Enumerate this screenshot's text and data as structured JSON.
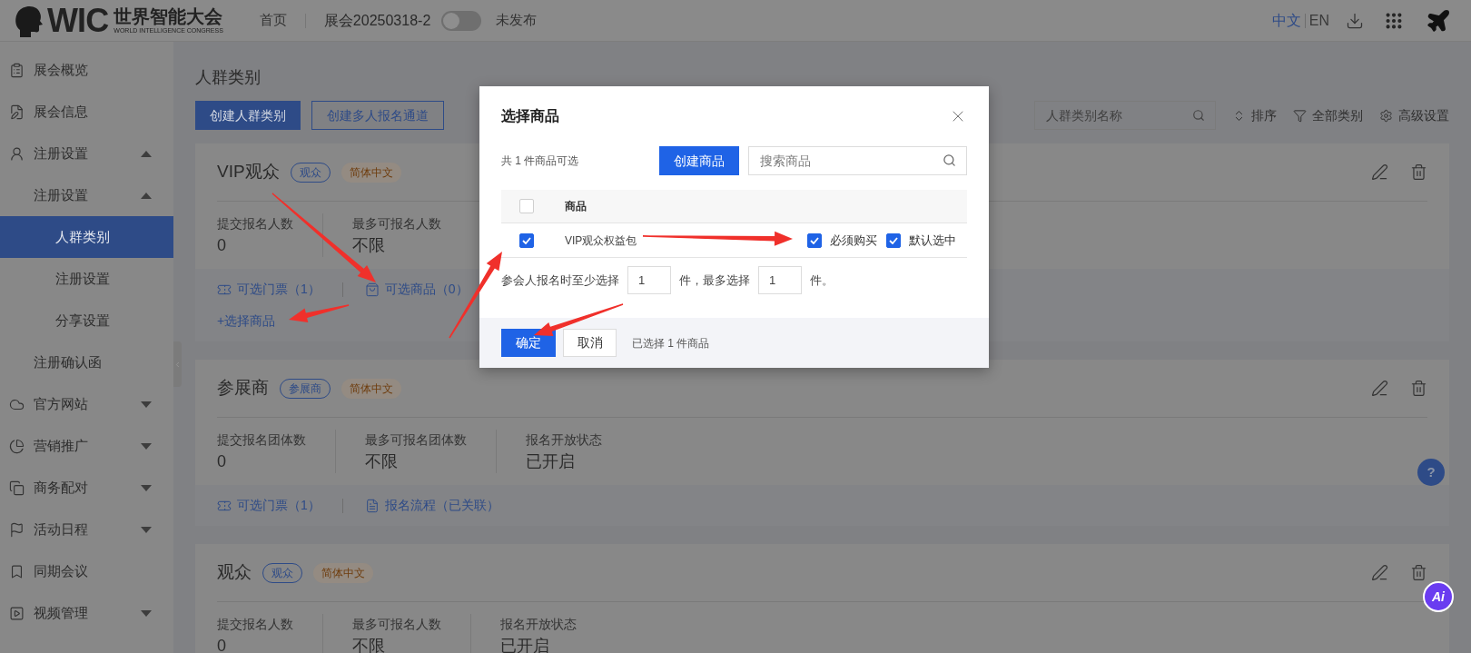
{
  "header": {
    "logo": {
      "mark": "WIC",
      "name": "世界智能大会",
      "subtitle": "WORLD INTELLIGENCE CONGRESS"
    },
    "nav": "首页",
    "event": "展会20250318-2",
    "publish_toggle": {
      "on": false
    },
    "status": "未发布",
    "languages": [
      {
        "label": "中文",
        "selected": true
      },
      {
        "label": "EN",
        "selected": false
      }
    ]
  },
  "sidebar": {
    "items": [
      {
        "label": "展会概览",
        "selected": false
      },
      {
        "label": "展会信息",
        "selected": false
      },
      {
        "label": "注册设置",
        "selected": false,
        "expanded": true,
        "children": [
          {
            "label": "注册设置",
            "selected": false,
            "expanded": true,
            "children": [
              {
                "label": "人群类别",
                "selected": true
              },
              {
                "label": "注册设置",
                "selected": false
              },
              {
                "label": "分享设置",
                "selected": false
              }
            ]
          },
          {
            "label": "注册确认函",
            "selected": false
          }
        ]
      },
      {
        "label": "官方网站",
        "selected": false,
        "expanded": false
      },
      {
        "label": "营销推广",
        "selected": false,
        "expanded": false
      },
      {
        "label": "商务配对",
        "selected": false,
        "expanded": false
      },
      {
        "label": "活动日程",
        "selected": false,
        "expanded": false
      },
      {
        "label": "同期会议",
        "selected": false
      },
      {
        "label": "视频管理",
        "selected": false,
        "expanded": false
      }
    ]
  },
  "page": {
    "title": "人群类别",
    "buttons": [
      {
        "label": "创建人群类别",
        "kind": "primary"
      },
      {
        "label": "创建多人报名通道",
        "kind": "outline"
      }
    ],
    "search": {
      "placeholder": "人群类别名称"
    },
    "tools": [
      {
        "label": "排序",
        "kind": "sort"
      },
      {
        "label": "全部类别",
        "kind": "filter"
      },
      {
        "label": "高级设置",
        "kind": "settings"
      }
    ]
  },
  "cards": [
    {
      "title": "VIP观众",
      "tags": [
        {
          "label": "观众",
          "kind": "type"
        },
        {
          "label": "简体中文",
          "kind": "language"
        }
      ],
      "stats": [
        {
          "label": "提交报名人数",
          "value": "0"
        },
        {
          "label": "最多可报名人数",
          "value": "不限"
        }
      ],
      "links": [
        {
          "label": "可选门票（1）",
          "kind": "ticket"
        },
        {
          "label": "可选商品（0）",
          "kind": "bag"
        }
      ],
      "action": "+选择商品"
    },
    {
      "title": "参展商",
      "tags": [
        {
          "label": "参展商",
          "kind": "type"
        },
        {
          "label": "简体中文",
          "kind": "language"
        }
      ],
      "stats": [
        {
          "label": "提交报名团体数",
          "value": "0"
        },
        {
          "label": "最多可报名团体数",
          "value": "不限"
        },
        {
          "label": "报名开放状态",
          "value": "已开启"
        }
      ],
      "links": [
        {
          "label": "可选门票（1）",
          "kind": "ticket"
        },
        {
          "label": "报名流程（已关联）",
          "kind": "form"
        }
      ]
    },
    {
      "title": "观众",
      "tags": [
        {
          "label": "观众",
          "kind": "type"
        },
        {
          "label": "简体中文",
          "kind": "language"
        }
      ],
      "stats": [
        {
          "label": "提交报名人数",
          "value": "0"
        },
        {
          "label": "最多可报名人数",
          "value": "不限"
        },
        {
          "label": "报名开放状态",
          "value": "已开启"
        }
      ]
    }
  ],
  "modal": {
    "title": "选择商品",
    "count": "共 1 件商品可选",
    "create_button": "创建商品",
    "search": {
      "placeholder": "搜索商品"
    },
    "table": {
      "select_all": {
        "checked": false
      },
      "column": "商品",
      "rows": [
        {
          "name": "VIP观众权益包",
          "selected": true,
          "options": [
            {
              "label": "必须购买",
              "checked": true
            },
            {
              "label": "默认选中",
              "checked": true
            }
          ]
        }
      ]
    },
    "limits": {
      "prefix": "参会人报名时至少选择",
      "min": "1",
      "middle": "件，最多选择",
      "max": "1",
      "suffix": "件。"
    },
    "confirm": "确定",
    "cancel": "取消",
    "summary": "已选择 1 件商品"
  },
  "floating": {
    "help": "?",
    "ai": "Ai"
  }
}
